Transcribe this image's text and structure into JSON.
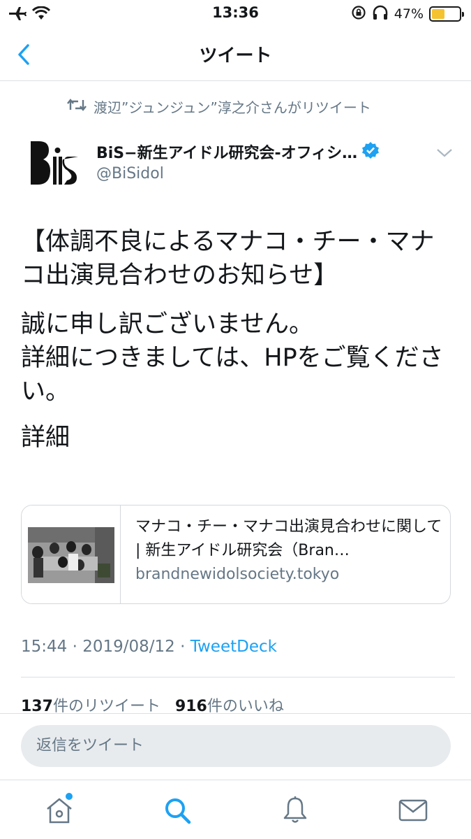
{
  "status_bar": {
    "time": "13:36",
    "battery_percent": "47%",
    "battery_level": 0.47,
    "battery_color": "#f5c330"
  },
  "nav": {
    "back_icon": "chevron-left-icon",
    "title": "ツイート"
  },
  "retweet_context": {
    "text": "渡辺”ジュンジュン”淳之介さんがリツイート"
  },
  "author": {
    "name": "BiS−新生アイドル研究会-オフィシ…",
    "handle": "@BiSidol",
    "verified": true
  },
  "tweet": {
    "line1": "【体調不良によるマナコ・チー・マナコ出演見合わせのお知らせ】",
    "line2": "誠に申し訳ございません。",
    "line3": "詳細につきましては、HPをご覧ください。",
    "link_text": "詳細"
  },
  "link_card": {
    "title": "マナコ・チー・マナコ出演見合わせに関して | 新生アイドル研究会（Bran…",
    "domain": "brandnewidolsociety.tokyo"
  },
  "meta": {
    "time": "15:44",
    "separator": "·",
    "date": "2019/08/12",
    "source": "TweetDeck"
  },
  "stats": {
    "retweet_count": "137",
    "retweet_label": "件のリツイート",
    "like_count": "916",
    "like_label": "件のいいね"
  },
  "reply": {
    "placeholder": "返信をツイート"
  },
  "tab_bar": {
    "items": [
      "home-icon",
      "search-icon",
      "bell-icon",
      "mail-icon"
    ],
    "active": "search-icon"
  },
  "colors": {
    "accent": "#1da1f2",
    "secondary_text": "#657786"
  }
}
